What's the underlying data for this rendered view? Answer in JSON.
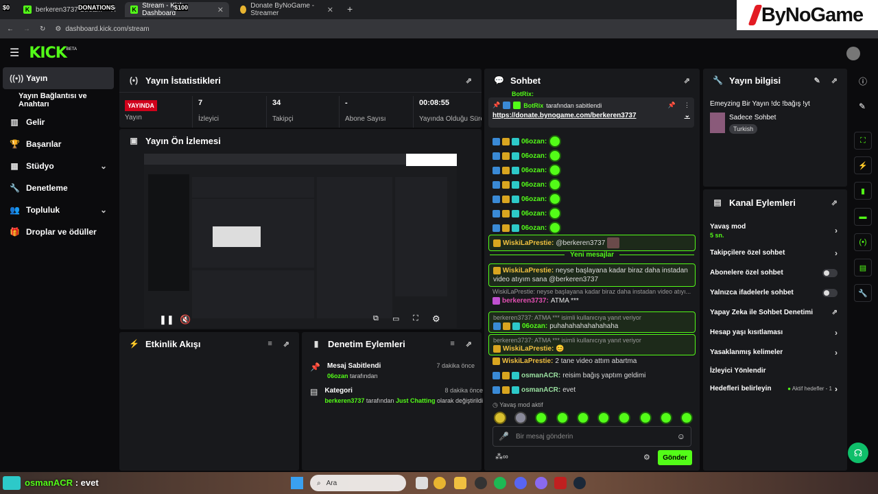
{
  "browser": {
    "tabs": [
      {
        "title": "berkeren3737 Stream"
      },
      {
        "title": "Stream - Kick Dashboard"
      },
      {
        "title": "Donate ByNoGame - Streamer"
      }
    ],
    "overlay_left": "$0",
    "overlay_donations": "DONATIONS",
    "overlay_amount": "$100",
    "url": "dashboard.kick.com/stream"
  },
  "logo_text": "ByNoGame",
  "kick_logo": "KICK",
  "kick_beta": "BETA",
  "sidebar": {
    "items": [
      {
        "label": "Yayın",
        "icon": "broadcast-icon"
      },
      {
        "label": "Yayın Bağlantısı ve Anahtarı",
        "icon": ""
      },
      {
        "label": "Gelir",
        "icon": "chart-icon"
      },
      {
        "label": "Başarılar",
        "icon": "trophy-icon"
      },
      {
        "label": "Stüdyo",
        "icon": "studio-icon"
      },
      {
        "label": "Denetleme",
        "icon": "wrench-icon"
      },
      {
        "label": "Topluluk",
        "icon": "people-icon"
      },
      {
        "label": "Droplar ve ödüller",
        "icon": "gift-icon"
      }
    ]
  },
  "stats": {
    "title": "Yayın İstatistikleri",
    "live_badge": "YAYINDA",
    "live_label": "Yayın",
    "viewers_value": "7",
    "viewers_label": "İzleyici",
    "followers_value": "34",
    "followers_label": "Takipçi",
    "subs_value": "-",
    "subs_label": "Abone Sayısı",
    "duration_value": "00:08:55",
    "duration_label": "Yayında Olduğu Süre"
  },
  "preview": {
    "title": "Yayın Ön İzlemesi"
  },
  "activity": {
    "title": "Etkinlik Akışı"
  },
  "moderation": {
    "title": "Denetim Eylemleri",
    "items": [
      {
        "title": "Mesaj Sabitlendi",
        "time": "7 dakika önce",
        "user": "06ozan",
        "suffix": "tarafından"
      },
      {
        "title": "Kategori",
        "time": "8 dakika önce",
        "user": "berkeren3737",
        "mid": "tarafından",
        "value": "Just Chatting",
        "suffix": "olarak değiştirildi"
      }
    ]
  },
  "chat": {
    "title": "Sohbet",
    "pinned_by_user": "BotRix",
    "pinned_by_text": "tarafından sabitlendi",
    "pinned_link": "https://donate.bynogame.com/berkeren3737",
    "top_cut_user": "BotRix:",
    "emote_lines": [
      {
        "user": "06ozan:"
      },
      {
        "user": "06ozan:"
      },
      {
        "user": "06ozan:"
      },
      {
        "user": "06ozan:"
      },
      {
        "user": "06ozan:"
      },
      {
        "user": "06ozan:"
      },
      {
        "user": "06ozan:"
      }
    ],
    "msg_mention": {
      "user": "WiskiLaPrestie:",
      "text": "@berkeren3737"
    },
    "new_messages": "Yeni mesajlar",
    "msg_long": {
      "user": "WiskiLaPrestie:",
      "text": "neyse başlayana kadar biraz daha instadan video atıyım sana @berkeren3737"
    },
    "reply1_context": "WiskiLaPrestie: neyse başlayana kadar biraz daha instadan video atıyı...",
    "reply1": {
      "user": "berkeren3737:",
      "text": "ATMA ***"
    },
    "reply2_context": "berkeren3737: ATMA *** isimli kullanıcıya yanıt veriyor",
    "reply2": {
      "user": "06ozan:",
      "text": "puhahahahahahahaha"
    },
    "reply3_context": "berkeren3737: ATMA *** isimli kullanıcıya yanıt veriyor",
    "reply3": {
      "user": "WiskiLaPrestie:",
      "text": "😊"
    },
    "msg_video": {
      "user": "WiskiLaPrestie:",
      "text": "2 tane video attım abartma"
    },
    "msg_osman1": {
      "user": "osmanACR:",
      "text": "reisim bağış yaptım geldimi"
    },
    "msg_osman2": {
      "user": "osmanACR:",
      "text": "evet"
    },
    "slow_mode": "Yavaş mod aktif",
    "input_placeholder": "Bir mesaj gönderin",
    "send_label": "Gönder"
  },
  "stream_info": {
    "title": "Yayın bilgisi",
    "stream_title": "Emeyzing Bir Yayın !dc !bağış !yt",
    "category": "Sadece Sohbet",
    "language": "Turkish"
  },
  "channel_actions": {
    "title": "Kanal Eylemleri",
    "slow_mode_label": "Yavaş mod",
    "slow_mode_value": "5 sn.",
    "followers_only": "Takipçilere özel sohbet",
    "subs_only": "Abonelere özel sohbet",
    "emotes_only": "Yalnızca ifadelerle sohbet",
    "ai_moderation": "Yapay Zeka ile Sohbet Denetimi",
    "account_age": "Hesap yaşı kısıtlaması",
    "banned_words": "Yasaklanmış kelimeler",
    "raid": "İzleyici Yönlendir",
    "goals": "Hedefleri belirleyin",
    "goals_status": "Aktif hedefler - 1"
  },
  "overlay_bottom": {
    "user": "osmanACR",
    "text": ": evet"
  },
  "taskbar": {
    "search_placeholder": "Ara"
  },
  "colors": {
    "accent": "#53fc18",
    "live": "#d0021b",
    "panel": "#18191c"
  }
}
